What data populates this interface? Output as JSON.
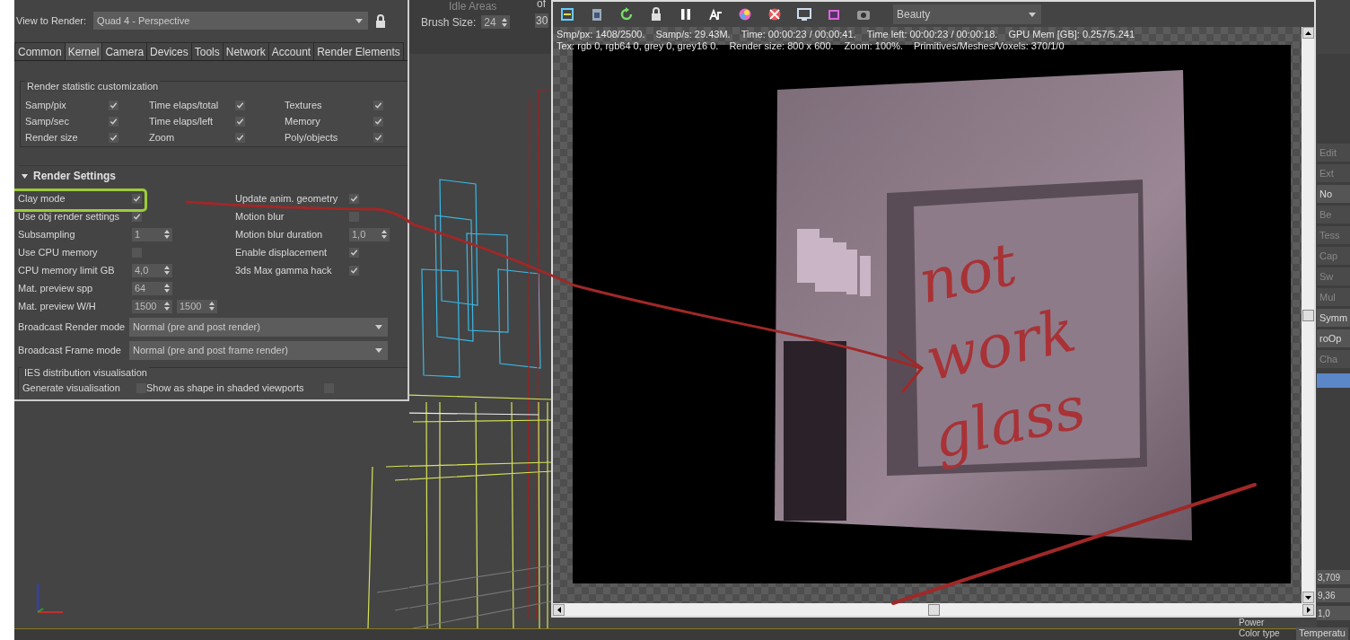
{
  "render_setup": {
    "view_label": "View to Render:",
    "view_value": "Quad 4 - Perspective",
    "tabs": [
      {
        "label": "Common",
        "selected": false
      },
      {
        "label": "Kernel",
        "selected": true
      },
      {
        "label": "Camera",
        "selected": false
      },
      {
        "label": "Devices",
        "selected": false
      },
      {
        "label": "Tools",
        "selected": false
      },
      {
        "label": "Network",
        "selected": false
      },
      {
        "label": "Account",
        "selected": false
      },
      {
        "label": "Render Elements",
        "selected": false
      }
    ],
    "stats_group": {
      "title": "Render statistic customization",
      "items": [
        {
          "label": "Samp/pix",
          "checked": true
        },
        {
          "label": "Time elaps/total",
          "checked": true
        },
        {
          "label": "Textures",
          "checked": true
        },
        {
          "label": "Samp/sec",
          "checked": true
        },
        {
          "label": "Time elaps/left",
          "checked": true
        },
        {
          "label": "Memory",
          "checked": true
        },
        {
          "label": "Render size",
          "checked": true
        },
        {
          "label": "Zoom",
          "checked": true
        },
        {
          "label": "Poly/objects",
          "checked": true
        }
      ]
    },
    "section": {
      "title": "Render Settings",
      "expanded": true
    },
    "rows": [
      {
        "kind": "pair",
        "items": [
          {
            "kind": "check",
            "label": "Clay mode",
            "checked": true,
            "highlighted": true
          },
          {
            "kind": "check",
            "label": "Update anim. geometry",
            "checked": true,
            "highlighted": false
          }
        ]
      },
      {
        "kind": "pair",
        "items": [
          {
            "kind": "check",
            "label": "Use obj render settings",
            "checked": true,
            "highlighted": false
          },
          {
            "kind": "check",
            "label": "Motion blur",
            "checked": false,
            "highlighted": false
          }
        ]
      },
      {
        "kind": "pair",
        "items": [
          {
            "kind": "spin",
            "label": "Subsampling",
            "value": "1"
          },
          {
            "kind": "spin",
            "label": "Motion blur duration",
            "value": "1,0"
          }
        ]
      },
      {
        "kind": "pair",
        "items": [
          {
            "kind": "check",
            "label": "Use CPU memory",
            "checked": false,
            "highlighted": false
          },
          {
            "kind": "check",
            "label": "Enable displacement",
            "checked": true,
            "highlighted": false
          }
        ]
      },
      {
        "kind": "pair",
        "items": [
          {
            "kind": "spin",
            "label": "CPU memory limit GB",
            "value": "4,0"
          },
          {
            "kind": "check",
            "label": "3ds Max gamma hack",
            "checked": true,
            "highlighted": false
          }
        ]
      },
      {
        "kind": "pair",
        "items": [
          {
            "kind": "spin",
            "label": "Mat. preview spp",
            "value": "64"
          }
        ]
      },
      {
        "kind": "pair",
        "items": [
          {
            "kind": "spin2",
            "label": "Mat. preview W/H",
            "values": [
              "1500",
              "1500"
            ]
          }
        ]
      },
      {
        "kind": "dropdown",
        "label": "Broadcast Render mode",
        "value": "Normal (pre and post render)"
      },
      {
        "kind": "dropdown",
        "label": "Broadcast Frame mode",
        "value": "Normal (pre and post frame render)"
      }
    ],
    "ies_group": {
      "title": "IES distribution visualisation",
      "items": [
        {
          "label": "Generate visualisation",
          "checked": false
        },
        {
          "label": "Show as shape in shaded viewports",
          "checked": false
        }
      ]
    }
  },
  "brush_panel": {
    "heading": "Idle Areas",
    "label": "Brush Size:",
    "value": "24",
    "column_label": "of",
    "column_value": "30"
  },
  "frame_buffer": {
    "channel": "Beauty",
    "stats": [
      [
        "Smp/px: 1408/2500.",
        "Samp/s: 29.43M.",
        "Time: 00:00:23 / 00:00:41.",
        "Time left: 00:00:23 / 00:00:18.",
        "GPU Mem [GB]: 0.257/5.241"
      ],
      [
        "Tex: rgb 0, rgb64 0, grey 0, grey16 0.",
        "Render size: 800 x 600.",
        "Zoom: 100%.",
        "Primitives/Meshes/Voxels: 370/1/0"
      ]
    ],
    "annotation": [
      "not",
      "work",
      "glass"
    ]
  },
  "side_panel": {
    "buttons": [
      {
        "label": "Edit",
        "disabled": true
      },
      {
        "label": "Ext",
        "disabled": true
      },
      {
        "label": "No",
        "disabled": false
      },
      {
        "label": "Be",
        "disabled": true
      },
      {
        "label": "Tess",
        "disabled": true
      },
      {
        "label": "Cap",
        "disabled": true
      },
      {
        "label": "Sw",
        "disabled": true
      },
      {
        "label": "Mul",
        "disabled": true
      },
      {
        "label": "Symm",
        "disabled": false
      },
      {
        "label": "roOp",
        "disabled": false
      },
      {
        "label": "Cha",
        "disabled": true
      }
    ],
    "values": [
      "3,709",
      "9,36",
      "1,0"
    ],
    "bottom_label": "Temperatu"
  },
  "property_labels": [
    "Power",
    "Color type"
  ]
}
